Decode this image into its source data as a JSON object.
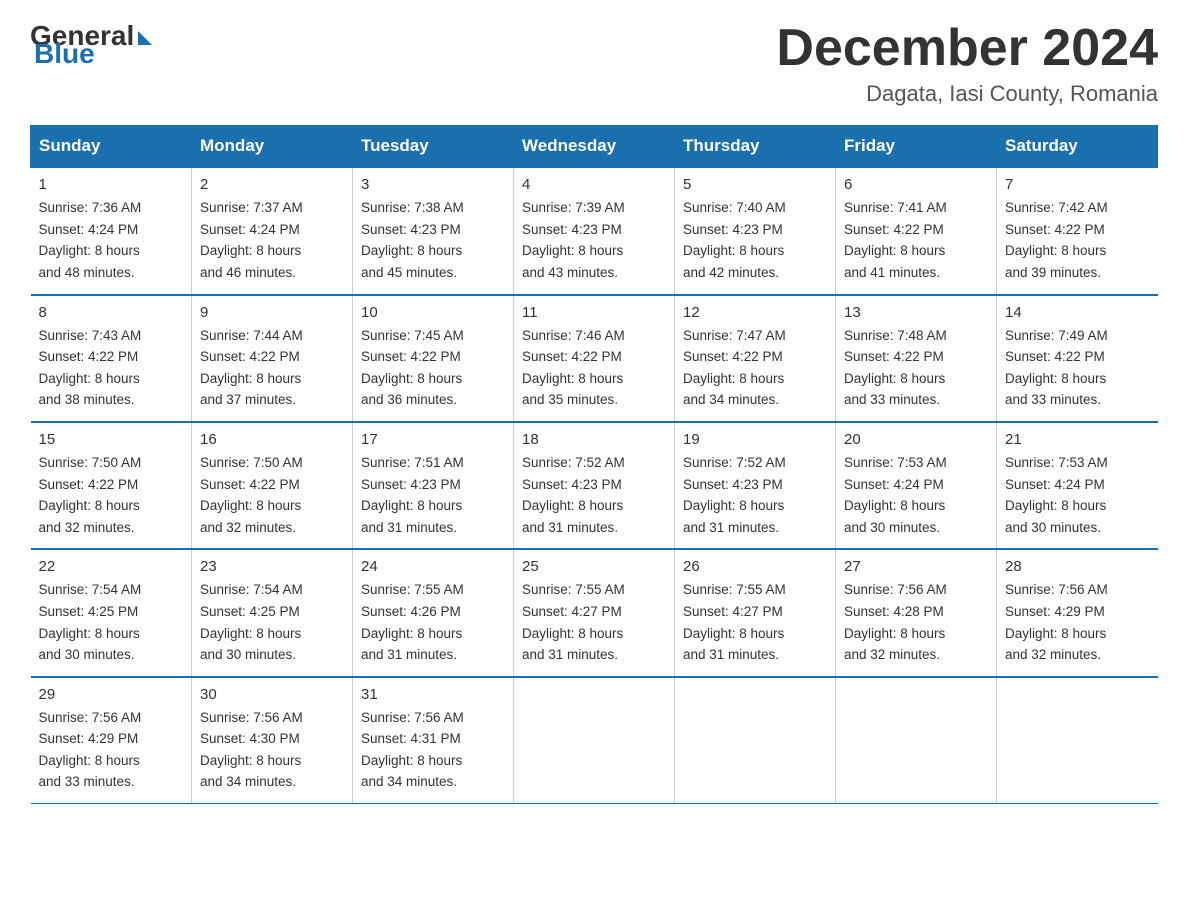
{
  "logo": {
    "general": "General",
    "blue": "Blue"
  },
  "title": "December 2024",
  "location": "Dagata, Iasi County, Romania",
  "days_of_week": [
    "Sunday",
    "Monday",
    "Tuesday",
    "Wednesday",
    "Thursday",
    "Friday",
    "Saturday"
  ],
  "weeks": [
    [
      {
        "day": "1",
        "sunrise": "7:36 AM",
        "sunset": "4:24 PM",
        "daylight": "8 hours and 48 minutes."
      },
      {
        "day": "2",
        "sunrise": "7:37 AM",
        "sunset": "4:24 PM",
        "daylight": "8 hours and 46 minutes."
      },
      {
        "day": "3",
        "sunrise": "7:38 AM",
        "sunset": "4:23 PM",
        "daylight": "8 hours and 45 minutes."
      },
      {
        "day": "4",
        "sunrise": "7:39 AM",
        "sunset": "4:23 PM",
        "daylight": "8 hours and 43 minutes."
      },
      {
        "day": "5",
        "sunrise": "7:40 AM",
        "sunset": "4:23 PM",
        "daylight": "8 hours and 42 minutes."
      },
      {
        "day": "6",
        "sunrise": "7:41 AM",
        "sunset": "4:22 PM",
        "daylight": "8 hours and 41 minutes."
      },
      {
        "day": "7",
        "sunrise": "7:42 AM",
        "sunset": "4:22 PM",
        "daylight": "8 hours and 39 minutes."
      }
    ],
    [
      {
        "day": "8",
        "sunrise": "7:43 AM",
        "sunset": "4:22 PM",
        "daylight": "8 hours and 38 minutes."
      },
      {
        "day": "9",
        "sunrise": "7:44 AM",
        "sunset": "4:22 PM",
        "daylight": "8 hours and 37 minutes."
      },
      {
        "day": "10",
        "sunrise": "7:45 AM",
        "sunset": "4:22 PM",
        "daylight": "8 hours and 36 minutes."
      },
      {
        "day": "11",
        "sunrise": "7:46 AM",
        "sunset": "4:22 PM",
        "daylight": "8 hours and 35 minutes."
      },
      {
        "day": "12",
        "sunrise": "7:47 AM",
        "sunset": "4:22 PM",
        "daylight": "8 hours and 34 minutes."
      },
      {
        "day": "13",
        "sunrise": "7:48 AM",
        "sunset": "4:22 PM",
        "daylight": "8 hours and 33 minutes."
      },
      {
        "day": "14",
        "sunrise": "7:49 AM",
        "sunset": "4:22 PM",
        "daylight": "8 hours and 33 minutes."
      }
    ],
    [
      {
        "day": "15",
        "sunrise": "7:50 AM",
        "sunset": "4:22 PM",
        "daylight": "8 hours and 32 minutes."
      },
      {
        "day": "16",
        "sunrise": "7:50 AM",
        "sunset": "4:22 PM",
        "daylight": "8 hours and 32 minutes."
      },
      {
        "day": "17",
        "sunrise": "7:51 AM",
        "sunset": "4:23 PM",
        "daylight": "8 hours and 31 minutes."
      },
      {
        "day": "18",
        "sunrise": "7:52 AM",
        "sunset": "4:23 PM",
        "daylight": "8 hours and 31 minutes."
      },
      {
        "day": "19",
        "sunrise": "7:52 AM",
        "sunset": "4:23 PM",
        "daylight": "8 hours and 31 minutes."
      },
      {
        "day": "20",
        "sunrise": "7:53 AM",
        "sunset": "4:24 PM",
        "daylight": "8 hours and 30 minutes."
      },
      {
        "day": "21",
        "sunrise": "7:53 AM",
        "sunset": "4:24 PM",
        "daylight": "8 hours and 30 minutes."
      }
    ],
    [
      {
        "day": "22",
        "sunrise": "7:54 AM",
        "sunset": "4:25 PM",
        "daylight": "8 hours and 30 minutes."
      },
      {
        "day": "23",
        "sunrise": "7:54 AM",
        "sunset": "4:25 PM",
        "daylight": "8 hours and 30 minutes."
      },
      {
        "day": "24",
        "sunrise": "7:55 AM",
        "sunset": "4:26 PM",
        "daylight": "8 hours and 31 minutes."
      },
      {
        "day": "25",
        "sunrise": "7:55 AM",
        "sunset": "4:27 PM",
        "daylight": "8 hours and 31 minutes."
      },
      {
        "day": "26",
        "sunrise": "7:55 AM",
        "sunset": "4:27 PM",
        "daylight": "8 hours and 31 minutes."
      },
      {
        "day": "27",
        "sunrise": "7:56 AM",
        "sunset": "4:28 PM",
        "daylight": "8 hours and 32 minutes."
      },
      {
        "day": "28",
        "sunrise": "7:56 AM",
        "sunset": "4:29 PM",
        "daylight": "8 hours and 32 minutes."
      }
    ],
    [
      {
        "day": "29",
        "sunrise": "7:56 AM",
        "sunset": "4:29 PM",
        "daylight": "8 hours and 33 minutes."
      },
      {
        "day": "30",
        "sunrise": "7:56 AM",
        "sunset": "4:30 PM",
        "daylight": "8 hours and 34 minutes."
      },
      {
        "day": "31",
        "sunrise": "7:56 AM",
        "sunset": "4:31 PM",
        "daylight": "8 hours and 34 minutes."
      },
      null,
      null,
      null,
      null
    ]
  ],
  "labels": {
    "sunrise": "Sunrise:",
    "sunset": "Sunset:",
    "daylight": "Daylight:"
  }
}
